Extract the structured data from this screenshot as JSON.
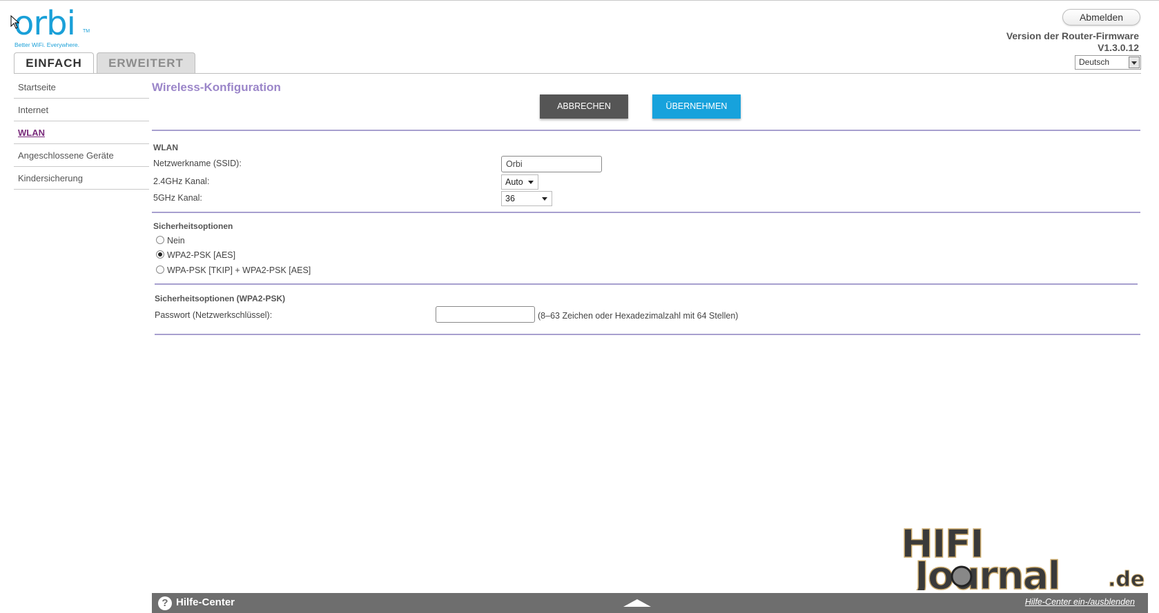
{
  "header": {
    "logo_text": "orbi",
    "logo_tm": "TM",
    "logo_tagline": "Better WiFi. Everywhere.",
    "tabs": [
      {
        "label": "EINFACH",
        "active": true
      },
      {
        "label": "ERWEITERT",
        "active": false
      }
    ],
    "logout_label": "Abmelden",
    "firmware_label": "Version der Router-Firmware",
    "firmware_version": "V1.3.0.12",
    "language": "Deutsch"
  },
  "sidebar": {
    "items": [
      {
        "label": "Startseite",
        "active": false
      },
      {
        "label": "Internet",
        "active": false
      },
      {
        "label": "WLAN",
        "active": true
      },
      {
        "label": "Angeschlossene Geräte",
        "active": false
      },
      {
        "label": "Kindersicherung",
        "active": false
      }
    ]
  },
  "main": {
    "title": "Wireless-Konfiguration",
    "cancel_label": "ABBRECHEN",
    "apply_label": "ÜBERNEHMEN",
    "wlan": {
      "section_title": "WLAN",
      "ssid_label": "Netzwerkname (SSID):",
      "ssid_value": "Orbi",
      "channel24_label": "2.4GHz Kanal:",
      "channel24_value": "Auto",
      "channel5_label": "5GHz Kanal:",
      "channel5_value": "36"
    },
    "security": {
      "section_title": "Sicherheitsoptionen",
      "options": [
        {
          "label": "Nein",
          "checked": false
        },
        {
          "label": "WPA2-PSK [AES]",
          "checked": true
        },
        {
          "label": "WPA-PSK [TKIP] + WPA2-PSK [AES]",
          "checked": false
        }
      ]
    },
    "wpa2": {
      "section_title": "Sicherheitsoptionen (WPA2-PSK)",
      "password_label": "Passwort (Netzwerkschlüssel):",
      "password_value": "",
      "password_hint": "(8–63 Zeichen oder Hexadezimalzahl mit 64 Stellen)"
    }
  },
  "help_center": {
    "title": "Hilfe-Center",
    "toggle_label": "Hilfe-Center ein-/ausblenden"
  },
  "watermark": {
    "text": "HIFI Journal.de"
  },
  "colors": {
    "accent_blue": "#17a2dc",
    "title_purple": "#9b86c9",
    "active_link": "#7a2b7c",
    "divider": "#a79fcf"
  }
}
